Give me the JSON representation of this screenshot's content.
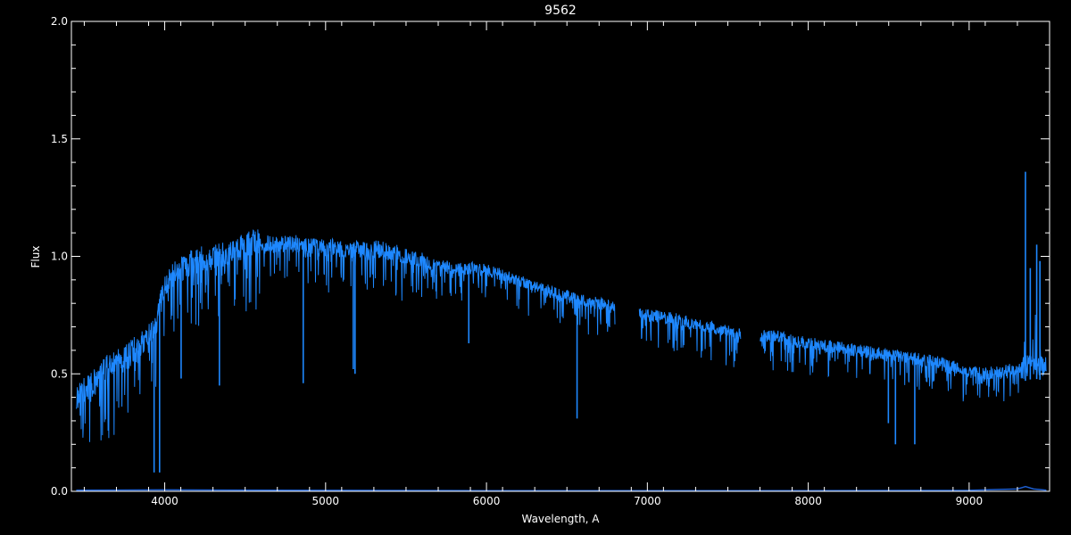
{
  "chart_data": {
    "type": "line",
    "title": "9562",
    "xlabel": "Wavelength, A",
    "ylabel": "Flux",
    "xlim": [
      3420,
      9500
    ],
    "ylim": [
      0.0,
      2.0
    ],
    "x_ticks": [
      4000,
      5000,
      6000,
      7000,
      8000,
      9000
    ],
    "x_tick_labels": [
      "4000",
      "5000",
      "6000",
      "7000",
      "8000",
      "9000"
    ],
    "y_ticks": [
      0.0,
      0.5,
      1.0,
      1.5,
      2.0
    ],
    "y_tick_labels": [
      "0.0",
      "0.5",
      "1.0",
      "1.5",
      "2.0"
    ],
    "grid": false,
    "colors": {
      "background": "#000000",
      "axes": "#ffffff",
      "flux": "#1e88ff",
      "error": "#1e5fd0"
    },
    "series": [
      {
        "role": "flux",
        "segments": [
          {
            "x": [
              3450,
              3500,
              3550,
              3600,
              3650,
              3700,
              3750,
              3800,
              3850,
              3900,
              3950,
              4000,
              4050,
              4100,
              4150,
              4200,
              4250,
              4300,
              4350,
              4400,
              4450,
              4500,
              4550,
              4600,
              4650,
              4700,
              4750,
              4800,
              4850,
              4900,
              4950,
              5000,
              5100,
              5200,
              5300,
              5400,
              5500,
              5600,
              5700,
              5800,
              5900,
              6000,
              6100,
              6200,
              6300,
              6400,
              6500,
              6600,
              6700,
              6800
            ],
            "y": [
              0.4,
              0.43,
              0.46,
              0.5,
              0.53,
              0.55,
              0.56,
              0.6,
              0.62,
              0.66,
              0.72,
              0.88,
              0.92,
              0.95,
              0.97,
              0.98,
              0.99,
              0.99,
              1.0,
              1.02,
              1.03,
              1.05,
              1.06,
              1.06,
              1.05,
              1.05,
              1.05,
              1.06,
              1.05,
              1.05,
              1.04,
              1.04,
              1.03,
              1.03,
              1.03,
              1.02,
              1.0,
              0.98,
              0.96,
              0.95,
              0.95,
              0.94,
              0.92,
              0.9,
              0.87,
              0.85,
              0.83,
              0.81,
              0.8,
              0.78
            ]
          },
          {
            "x": [
              6950,
              7000,
              7100,
              7200,
              7300,
              7400,
              7500,
              7580
            ],
            "y": [
              0.76,
              0.75,
              0.74,
              0.73,
              0.71,
              0.7,
              0.68,
              0.67
            ]
          },
          {
            "x": [
              7700,
              7800,
              7900,
              8000,
              8100,
              8200,
              8300,
              8400,
              8500,
              8600,
              8700,
              8800,
              8900,
              9000,
              9100,
              9200,
              9300,
              9400,
              9480
            ],
            "y": [
              0.66,
              0.66,
              0.64,
              0.63,
              0.62,
              0.61,
              0.6,
              0.59,
              0.58,
              0.57,
              0.56,
              0.55,
              0.53,
              0.51,
              0.5,
              0.51,
              0.52,
              0.54,
              0.53
            ]
          }
        ]
      },
      {
        "role": "error",
        "x": [
          3450,
          4000,
          5000,
          6000,
          7000,
          8000,
          9000,
          9300,
          9350,
          9400,
          9480
        ],
        "y": [
          0.005,
          0.006,
          0.004,
          0.003,
          0.003,
          0.003,
          0.004,
          0.01,
          0.02,
          0.01,
          0.005
        ]
      }
    ],
    "absorption_lines": [
      {
        "x": 3934,
        "y": 0.08
      },
      {
        "x": 3968,
        "y": 0.08
      },
      {
        "x": 4102,
        "y": 0.48
      },
      {
        "x": 4340,
        "y": 0.45
      },
      {
        "x": 4861,
        "y": 0.46
      },
      {
        "x": 5172,
        "y": 0.52
      },
      {
        "x": 5183,
        "y": 0.5
      },
      {
        "x": 5890,
        "y": 0.63
      },
      {
        "x": 6563,
        "y": 0.31
      },
      {
        "x": 8498,
        "y": 0.29
      },
      {
        "x": 8542,
        "y": 0.2
      },
      {
        "x": 8662,
        "y": 0.2
      }
    ],
    "emission_spikes": [
      {
        "x": 9350,
        "y": 1.36
      },
      {
        "x": 9380,
        "y": 0.95
      },
      {
        "x": 9420,
        "y": 1.05
      },
      {
        "x": 9440,
        "y": 0.98
      }
    ]
  }
}
